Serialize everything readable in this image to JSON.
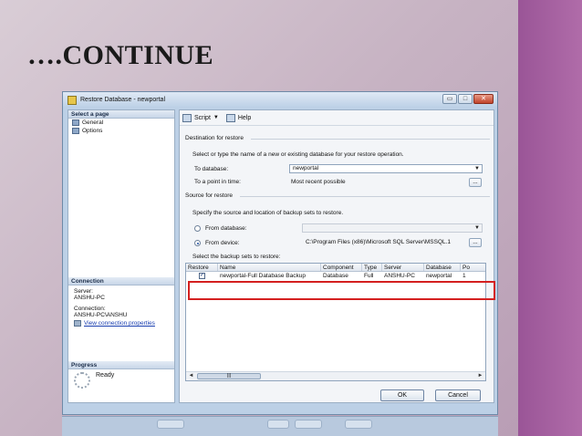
{
  "slide": {
    "title": "….CONTINUE"
  },
  "window": {
    "title": "Restore Database - newportal",
    "controls": {
      "minimize": "▭",
      "maximize": "□",
      "close": "✕"
    }
  },
  "left_pane": {
    "select_page_header": "Select a page",
    "pages": [
      {
        "label": "General",
        "icon": "page-icon"
      },
      {
        "label": "Options",
        "icon": "page-icon"
      }
    ],
    "connection_header": "Connection",
    "server_label": "Server:",
    "server_value": "ANSHU-PC",
    "connection_label": "Connection:",
    "connection_value": "ANSHU-PC\\ANSHU",
    "view_connection_link": "View connection properties",
    "progress_header": "Progress",
    "progress_status": "Ready"
  },
  "toolbar": {
    "script_label": "Script",
    "help_label": "Help"
  },
  "destination": {
    "header": "Destination for restore",
    "instruction": "Select or type the name of a new or existing database for your restore operation.",
    "to_database_label": "To database:",
    "to_database_value": "newportal",
    "point_in_time_label": "To a point in time:",
    "point_in_time_value": "Most recent possible"
  },
  "source": {
    "header": "Source for restore",
    "instruction": "Specify the source and location of backup sets to restore.",
    "from_database_label": "From database:",
    "from_device_label": "From device:",
    "from_device_value": "C:\\Program Files (x86)\\Microsoft SQL Server\\MSSQL.1",
    "selected_option": "From device",
    "backup_sets_label": "Select the backup sets to restore:"
  },
  "backup_table": {
    "columns": [
      "Restore",
      "Name",
      "Component",
      "Type",
      "Server",
      "Database",
      "Po"
    ],
    "rows": [
      {
        "restore": true,
        "name": "newportal-Full Database Backup",
        "component": "Database",
        "type": "Full",
        "server": "ANSHU-PC",
        "database": "newportal",
        "position": "1"
      }
    ]
  },
  "buttons": {
    "ok": "OK",
    "cancel": "Cancel",
    "ellipsis": "..."
  },
  "colors": {
    "accent_band": "#9a5597",
    "highlight": "#d42020",
    "link": "#1a3fb0"
  }
}
